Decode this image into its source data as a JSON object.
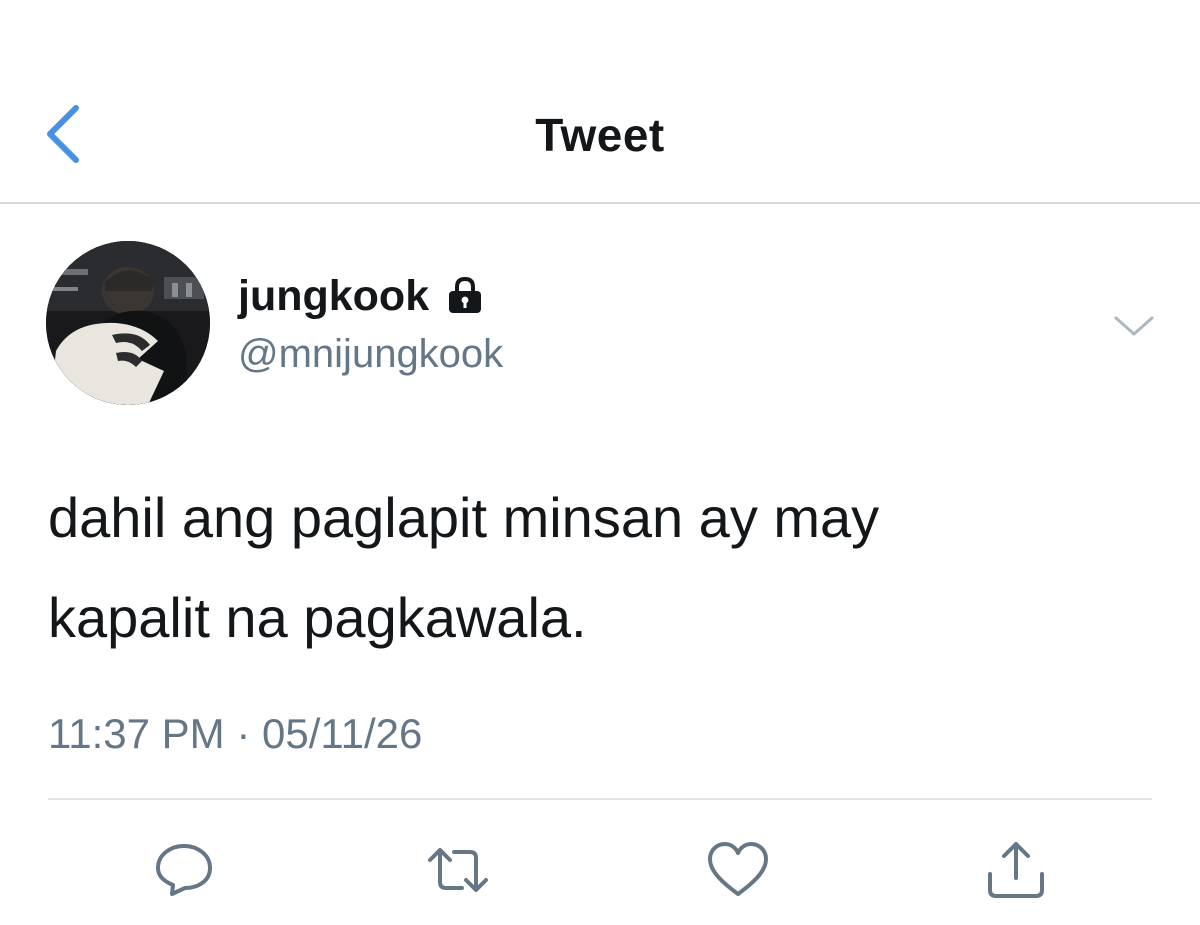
{
  "header": {
    "title": "Tweet",
    "back_icon": "chevron-left-icon",
    "accent_color": "#4a90e2"
  },
  "tweet": {
    "author": {
      "display_name": "jungkook",
      "handle": "@mnijungkook",
      "protected": true,
      "lock_icon": "lock-icon"
    },
    "text_line_1": "dahil ang paglapit minsan ay may",
    "text_line_2": "kapalit na pagkawala.",
    "timestamp": "11:37 PM · 05/11/26",
    "menu_icon": "chevron-down-icon"
  },
  "actions": [
    {
      "name": "reply",
      "icon": "reply-icon"
    },
    {
      "name": "retweet",
      "icon": "retweet-icon"
    },
    {
      "name": "like",
      "icon": "heart-icon"
    },
    {
      "name": "share",
      "icon": "share-icon"
    }
  ],
  "colors": {
    "text_primary": "#14171a",
    "text_secondary": "#657786",
    "divider": "#e1e4e7",
    "icon": "#657786"
  }
}
